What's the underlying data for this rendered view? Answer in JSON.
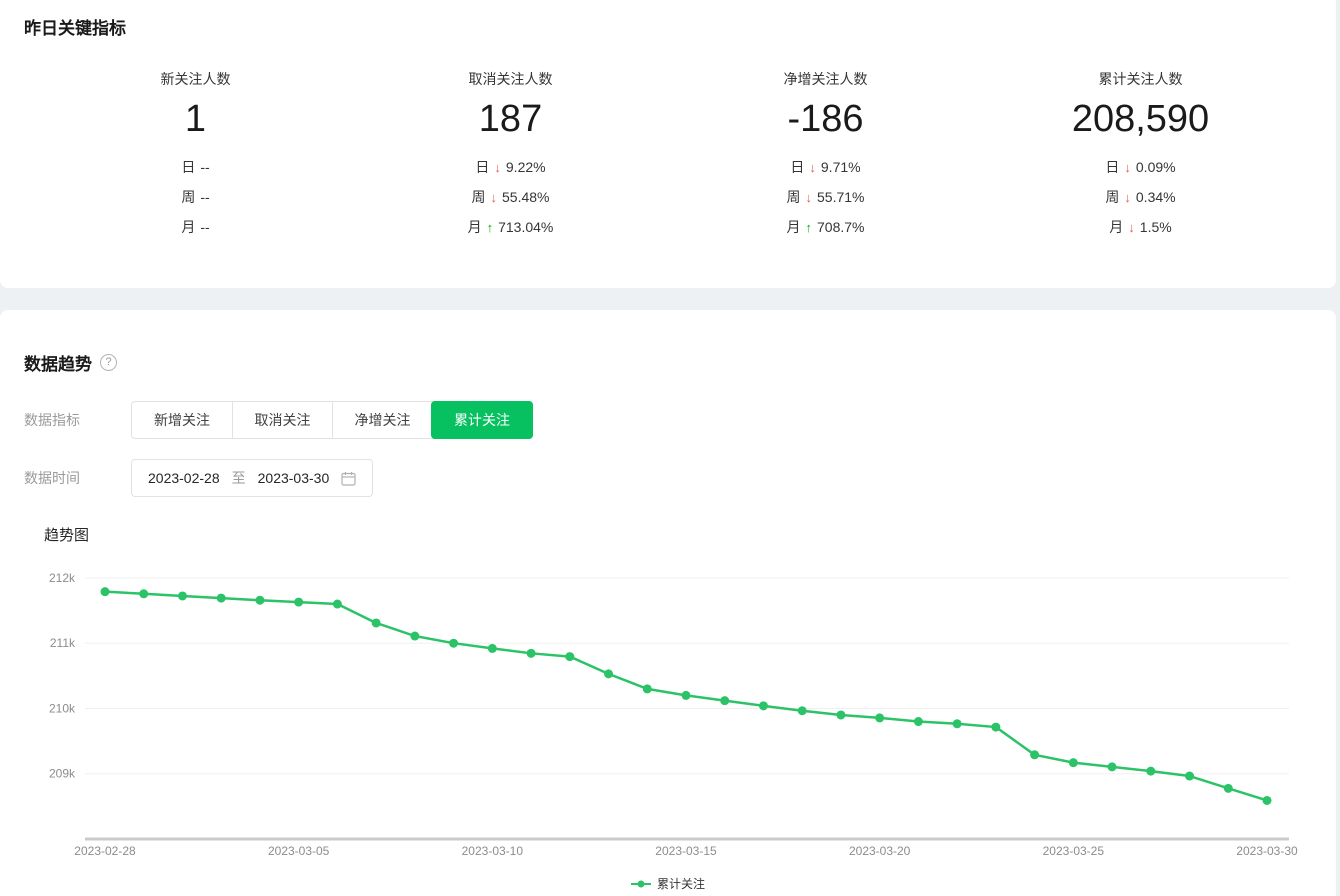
{
  "colors": {
    "accent_green": "#07c160",
    "line_green": "#2cc368",
    "trend_down_red": "#e25c5c",
    "trend_up_green": "#12a812"
  },
  "yesterday": {
    "section_title": "昨日关键指标",
    "items": [
      {
        "label": "新关注人数",
        "value": "1",
        "rows": [
          {
            "period": "日",
            "trend": "none",
            "arrow": "",
            "pct": "--"
          },
          {
            "period": "周",
            "trend": "none",
            "arrow": "",
            "pct": "--"
          },
          {
            "period": "月",
            "trend": "none",
            "arrow": "",
            "pct": "--"
          }
        ]
      },
      {
        "label": "取消关注人数",
        "value": "187",
        "rows": [
          {
            "period": "日",
            "trend": "down",
            "arrow": "↓",
            "pct": "9.22%"
          },
          {
            "period": "周",
            "trend": "down",
            "arrow": "↓",
            "pct": "55.48%"
          },
          {
            "period": "月",
            "trend": "up",
            "arrow": "↑",
            "pct": "713.04%"
          }
        ]
      },
      {
        "label": "净增关注人数",
        "value": "-186",
        "rows": [
          {
            "period": "日",
            "trend": "down",
            "arrow": "↓",
            "pct": "9.71%"
          },
          {
            "period": "周",
            "trend": "down",
            "arrow": "↓",
            "pct": "55.71%"
          },
          {
            "period": "月",
            "trend": "up",
            "arrow": "↑",
            "pct": "708.7%"
          }
        ]
      },
      {
        "label": "累计关注人数",
        "value": "208,590",
        "rows": [
          {
            "period": "日",
            "trend": "down",
            "arrow": "↓",
            "pct": "0.09%"
          },
          {
            "period": "周",
            "trend": "down",
            "arrow": "↓",
            "pct": "0.34%"
          },
          {
            "period": "月",
            "trend": "down",
            "arrow": "↓",
            "pct": "1.5%"
          }
        ]
      }
    ]
  },
  "trend": {
    "section_title": "数据趋势",
    "help_glyph": "?",
    "metric_label": "数据指标",
    "time_label": "数据时间",
    "tabs": [
      {
        "label": "新增关注",
        "active": false
      },
      {
        "label": "取消关注",
        "active": false
      },
      {
        "label": "净增关注",
        "active": false
      },
      {
        "label": "累计关注",
        "active": true
      }
    ],
    "date_from": "2023-02-28",
    "date_sep": "至",
    "date_to": "2023-03-30"
  },
  "chart_data": {
    "type": "line",
    "title": "趋势图",
    "x": [
      "2023-02-28",
      "2023-03-01",
      "2023-03-02",
      "2023-03-03",
      "2023-03-04",
      "2023-03-05",
      "2023-03-06",
      "2023-03-07",
      "2023-03-08",
      "2023-03-09",
      "2023-03-10",
      "2023-03-11",
      "2023-03-12",
      "2023-03-13",
      "2023-03-14",
      "2023-03-15",
      "2023-03-16",
      "2023-03-17",
      "2023-03-18",
      "2023-03-19",
      "2023-03-20",
      "2023-03-21",
      "2023-03-22",
      "2023-03-23",
      "2023-03-24",
      "2023-03-25",
      "2023-03-26",
      "2023-03-27",
      "2023-03-28",
      "2023-03-29",
      "2023-03-30"
    ],
    "series": [
      {
        "name": "累计关注",
        "color": "#2cc368",
        "values": [
          211790,
          211757,
          211724,
          211691,
          211658,
          211630,
          211600,
          211310,
          211110,
          211000,
          210920,
          210845,
          210795,
          210530,
          210300,
          210200,
          210120,
          210040,
          209965,
          209900,
          209855,
          209800,
          209765,
          209715,
          209290,
          209170,
          209105,
          209040,
          208965,
          208776,
          208590
        ]
      }
    ],
    "x_tick_labels": [
      "2023-02-28",
      "2023-03-05",
      "2023-03-10",
      "2023-03-15",
      "2023-03-20",
      "2023-03-25",
      "2023-03-30"
    ],
    "y_ticks": [
      209000,
      210000,
      211000,
      212000
    ],
    "y_tick_labels": [
      "209k",
      "210k",
      "211k",
      "212k"
    ],
    "ylim": [
      208000,
      212336
    ],
    "grid": true,
    "legend_position": "bottom"
  }
}
